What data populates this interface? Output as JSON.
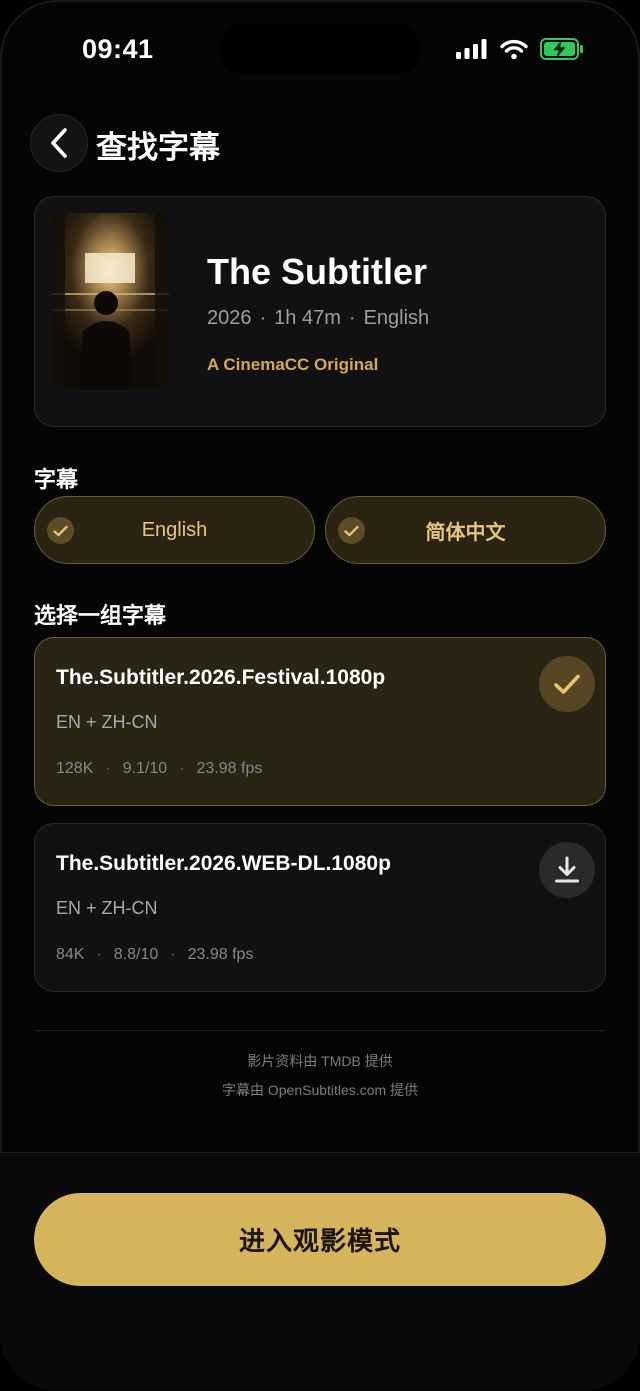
{
  "status_bar": {
    "time": "09:41"
  },
  "header": {
    "title": "查找字幕"
  },
  "movie": {
    "title": "The Subtitler",
    "year": "2026",
    "duration": "1h 47m",
    "language": "English",
    "meta_separator": "·",
    "tag": "A CinemaCC Original"
  },
  "subtitles_section": {
    "label": "字幕",
    "languages": [
      {
        "label": "English",
        "selected": true
      },
      {
        "label": "简体中文",
        "selected": true
      }
    ]
  },
  "releases_section": {
    "label": "选择一组字幕",
    "releases": [
      {
        "name": "The.Subtitler.2026.Festival.1080p",
        "langs": "EN + ZH-CN",
        "downloads": "128K",
        "rating": "9.1/10",
        "fps": "23.98 fps",
        "selected": true
      },
      {
        "name": "The.Subtitler.2026.WEB-DL.1080p",
        "langs": "EN + ZH-CN",
        "downloads": "84K",
        "rating": "8.8/10",
        "fps": "23.98 fps",
        "selected": false
      }
    ],
    "stat_separator": "·"
  },
  "credits": {
    "tmdb": "影片资料由 TMDB 提供",
    "opensubtitles": "字幕由 OpenSubtitles.com 提供"
  },
  "primary_action": {
    "label": "进入观影模式"
  },
  "colors": {
    "accent": "#d6b45c",
    "accent_text": "#d4a94f",
    "background": "#050505",
    "card": "#111113",
    "selected_card": "#2a2414",
    "battery": "#34c759"
  },
  "icons": {
    "back": "chevron-left-icon",
    "check": "check-icon",
    "download": "download-icon",
    "signal": "signal-icon",
    "wifi": "wifi-icon",
    "battery": "battery-charging-icon"
  }
}
